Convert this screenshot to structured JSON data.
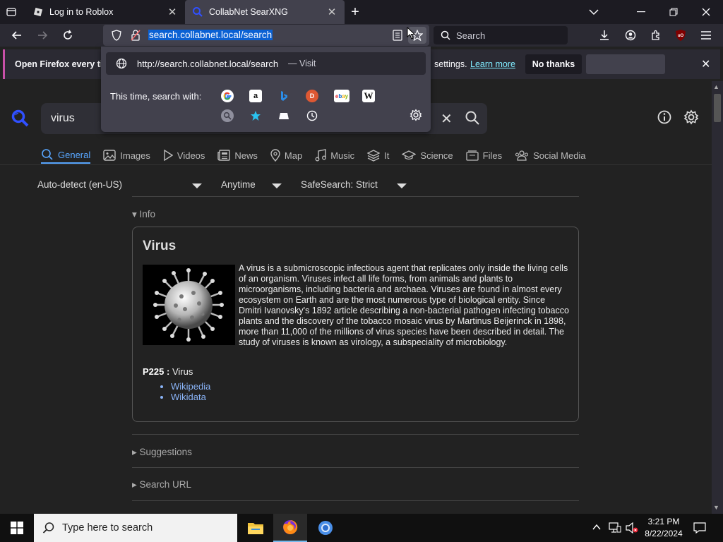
{
  "browser": {
    "tabs": [
      {
        "title": "Log in to Roblox",
        "active": false
      },
      {
        "title": "CollabNet SearXNG",
        "active": true
      }
    ],
    "url": "search.collabnet.local/search",
    "search_placeholder": "Search"
  },
  "notification": {
    "text_left": "Open Firefox every ti",
    "text_right": "settings.",
    "link": "Learn more",
    "button": "No thanks"
  },
  "urlbar_dropdown": {
    "suggestion_url": "http://search.collabnet.local/search",
    "suggestion_action": "— Visit",
    "search_with_label": "This time, search with:",
    "engines": [
      "google-icon",
      "amazon-icon",
      "bing-icon",
      "duckduckgo-icon",
      "ebay-icon",
      "wikipedia-icon",
      "search-engine-icon",
      "bookmarks-icon",
      "tabs-icon",
      "history-icon"
    ]
  },
  "searxng": {
    "query": "virus",
    "categories": [
      {
        "label": "General",
        "active": true
      },
      {
        "label": "Images"
      },
      {
        "label": "Videos"
      },
      {
        "label": "News"
      },
      {
        "label": "Map"
      },
      {
        "label": "Music"
      },
      {
        "label": "It"
      },
      {
        "label": "Science"
      },
      {
        "label": "Files"
      },
      {
        "label": "Social Media"
      }
    ],
    "filters": {
      "language": "Auto-detect (en-US)",
      "time": "Anytime",
      "safesearch": "SafeSearch: Strict"
    },
    "info_header": "▾ Info",
    "infobox": {
      "title": "Virus",
      "description": "A virus is a submicroscopic infectious agent that replicates only inside the living cells of an organism. Viruses infect all life forms, from animals and plants to microorganisms, including bacteria and archaea. Viruses are found in almost every ecosystem on Earth and are the most numerous type of biological entity. Since Dmitri Ivanovsky's 1892 article describing a non-bacterial pathogen infecting tobacco plants and the discovery of the tobacco mosaic virus by Martinus Beijerinck in 1898, more than 11,000 of the millions of virus species have been described in detail. The study of viruses is known as virology, a subspeciality of microbiology.",
      "property_key": "P225 :",
      "property_value": "Virus",
      "links": [
        "Wikipedia",
        "Wikidata"
      ]
    },
    "suggestions_header": "▸ Suggestions",
    "search_url_header": "▸ Search URL"
  },
  "taskbar": {
    "search_placeholder": "Type here to search",
    "time": "3:21 PM",
    "date": "8/22/2024"
  }
}
